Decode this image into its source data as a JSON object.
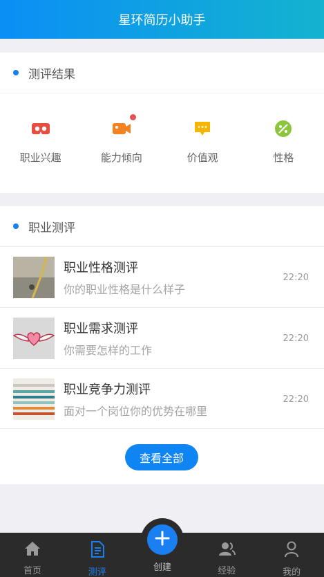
{
  "header": {
    "title": "星环简历小助手"
  },
  "result_section": {
    "title": "测评结果",
    "items": [
      {
        "label": "职业兴趣",
        "icon": "vr-glasses-icon",
        "color": "#e84e40"
      },
      {
        "label": "能力倾向",
        "icon": "video-camera-icon",
        "color": "#f58220",
        "badge": true
      },
      {
        "label": "价值观",
        "icon": "message-icon",
        "color": "#f7b500"
      },
      {
        "label": "性格",
        "icon": "leaf-icon",
        "color": "#8cc63f"
      }
    ]
  },
  "career_section": {
    "title": "职业测评",
    "rows": [
      {
        "title": "职业性格测评",
        "subtitle": "你的职业性格是什么样子",
        "time": "22:20",
        "thumb": "rope-photo"
      },
      {
        "title": "职业需求测评",
        "subtitle": "你需要怎样的工作",
        "time": "22:20",
        "thumb": "winged-heart"
      },
      {
        "title": "职业竞争力测评",
        "subtitle": "面对一个岗位你的优势在哪里",
        "time": "22:20",
        "thumb": "yarn-stripes"
      }
    ],
    "view_all": "查看全部"
  },
  "tabbar": {
    "tabs": [
      {
        "label": "首页",
        "icon": "home-icon"
      },
      {
        "label": "测评",
        "icon": "document-icon",
        "active": true
      },
      {
        "label": "创建",
        "icon": "plus-icon"
      },
      {
        "label": "经验",
        "icon": "users-icon"
      },
      {
        "label": "我的",
        "icon": "person-icon"
      }
    ]
  },
  "colors": {
    "accent": "#1a7ff0",
    "header_start": "#0a8ff5",
    "header_end": "#14b3cf",
    "tabbar": "#2b2b2b"
  }
}
